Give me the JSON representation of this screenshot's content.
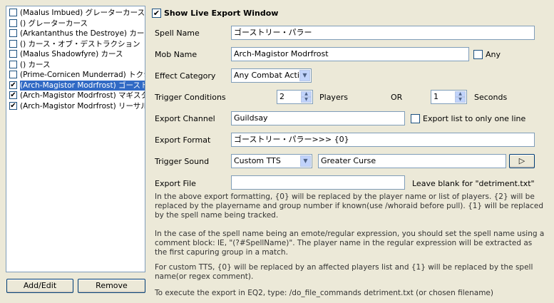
{
  "spell_list": [
    {
      "label": "(Maalus Imbued) グレーターカース",
      "checked": false,
      "selected": false
    },
    {
      "label": "() グレーターカース",
      "checked": false,
      "selected": false
    },
    {
      "label": "(Arkantanthus the Destroye) カース・オブ・デストラクション",
      "checked": false,
      "selected": false
    },
    {
      "label": "() カース・オブ・デストラクション",
      "checked": false,
      "selected": false
    },
    {
      "label": "(Maalus Shadowfyre) カース",
      "checked": false,
      "selected": false
    },
    {
      "label": "() カース",
      "checked": false,
      "selected": false
    },
    {
      "label": "(Prime-Cornicen Munderrad) トクシック",
      "checked": false,
      "selected": false
    },
    {
      "label": "(Arch-Magistor Modrfrost) ゴーストリー・パラー",
      "checked": true,
      "selected": true
    },
    {
      "label": "(Arch-Magistor Modrfrost) マギスター",
      "checked": true,
      "selected": false
    },
    {
      "label": "(Arch-Magistor Modrfrost) リーサル",
      "checked": true,
      "selected": false
    }
  ],
  "buttons": {
    "add_edit": "Add/Edit",
    "remove": "Remove",
    "play": "▷"
  },
  "live_export": {
    "label": "Show Live Export Window",
    "checked": true
  },
  "form": {
    "spell_name_label": "Spell Name",
    "spell_name": "ゴーストリー・パラー",
    "mob_name_label": "Mob Name",
    "mob_name": "Arch-Magistor Modrfrost",
    "any_label": "Any",
    "any_checked": false,
    "effect_category_label": "Effect Category",
    "effect_category": "Any Combat Actio",
    "trigger_conditions_label": "Trigger Conditions",
    "players_value": "2",
    "players_label": "Players",
    "or_label": "OR",
    "seconds_value": "1",
    "seconds_label": "Seconds",
    "export_channel_label": "Export Channel",
    "export_channel": "Guildsay",
    "one_line_label": "Export list to only one line",
    "one_line_checked": false,
    "export_format_label": "Export Format",
    "export_format": "ゴーストリー・パラー>>>  {0}",
    "trigger_sound_label": "Trigger Sound",
    "trigger_sound": "Custom TTS",
    "tts_text": "Greater Curse",
    "export_file_label": "Export File",
    "export_file": "",
    "export_file_hint": "Leave blank for \"detriment.txt\""
  },
  "help": {
    "p1_l1": "In the above export formatting, {0} will be replaced by the player name or list of players. {2} will be",
    "p1_l2": "replaced by the playername and group number if known(use /whoraid before pull).  {1} will be replaced",
    "p1_l3": "by the spell name being tracked.",
    "p2_l1": "In the case of the spell name being an emote/regular expression, you should set the spell name using a",
    "p2_l2": "comment block: IE, \"(?#SpellName)\".  The player name in the regular expression will be extracted as",
    "p2_l3": "the first capuring group in a match.",
    "p3_l1": "For custom TTS, {0} will be replaced by an affected players list and {1} will be replaced by the spell",
    "p3_l2": "name(or regex comment).",
    "p4_l1": "To execute the export in EQ2, type: /do_file_commands detriment.txt   (or chosen filename)"
  },
  "icons": {
    "check": "✔",
    "combo": "▼",
    "spin_up": "▲",
    "spin_down": "▼"
  }
}
